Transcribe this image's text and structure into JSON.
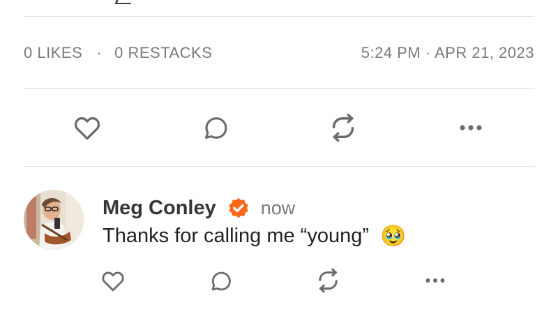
{
  "post_stats": {
    "likes_count": "0",
    "likes_label": "LIKES",
    "separator": "·",
    "restacks_count": "0",
    "restacks_label": "RESTACKS",
    "timestamp": "5:24 PM · APR 21, 2023"
  },
  "post_actions": {
    "icons": [
      "heart-icon",
      "comment-icon",
      "restack-icon",
      "more-icon"
    ]
  },
  "comment": {
    "author": "Meg Conley",
    "verified_icon": "verified-badge-icon",
    "verified_color": "#ff6719",
    "time": "now",
    "text": "Thanks for calling me “young”",
    "emoji": "🥹",
    "actions": {
      "icons": [
        "heart-icon",
        "comment-icon",
        "restack-icon",
        "more-icon"
      ]
    }
  },
  "colors": {
    "icon": "#6b6b6b",
    "muted_text": "#7a7a7a",
    "divider": "#e3e3e3",
    "accent": "#ff6719"
  }
}
